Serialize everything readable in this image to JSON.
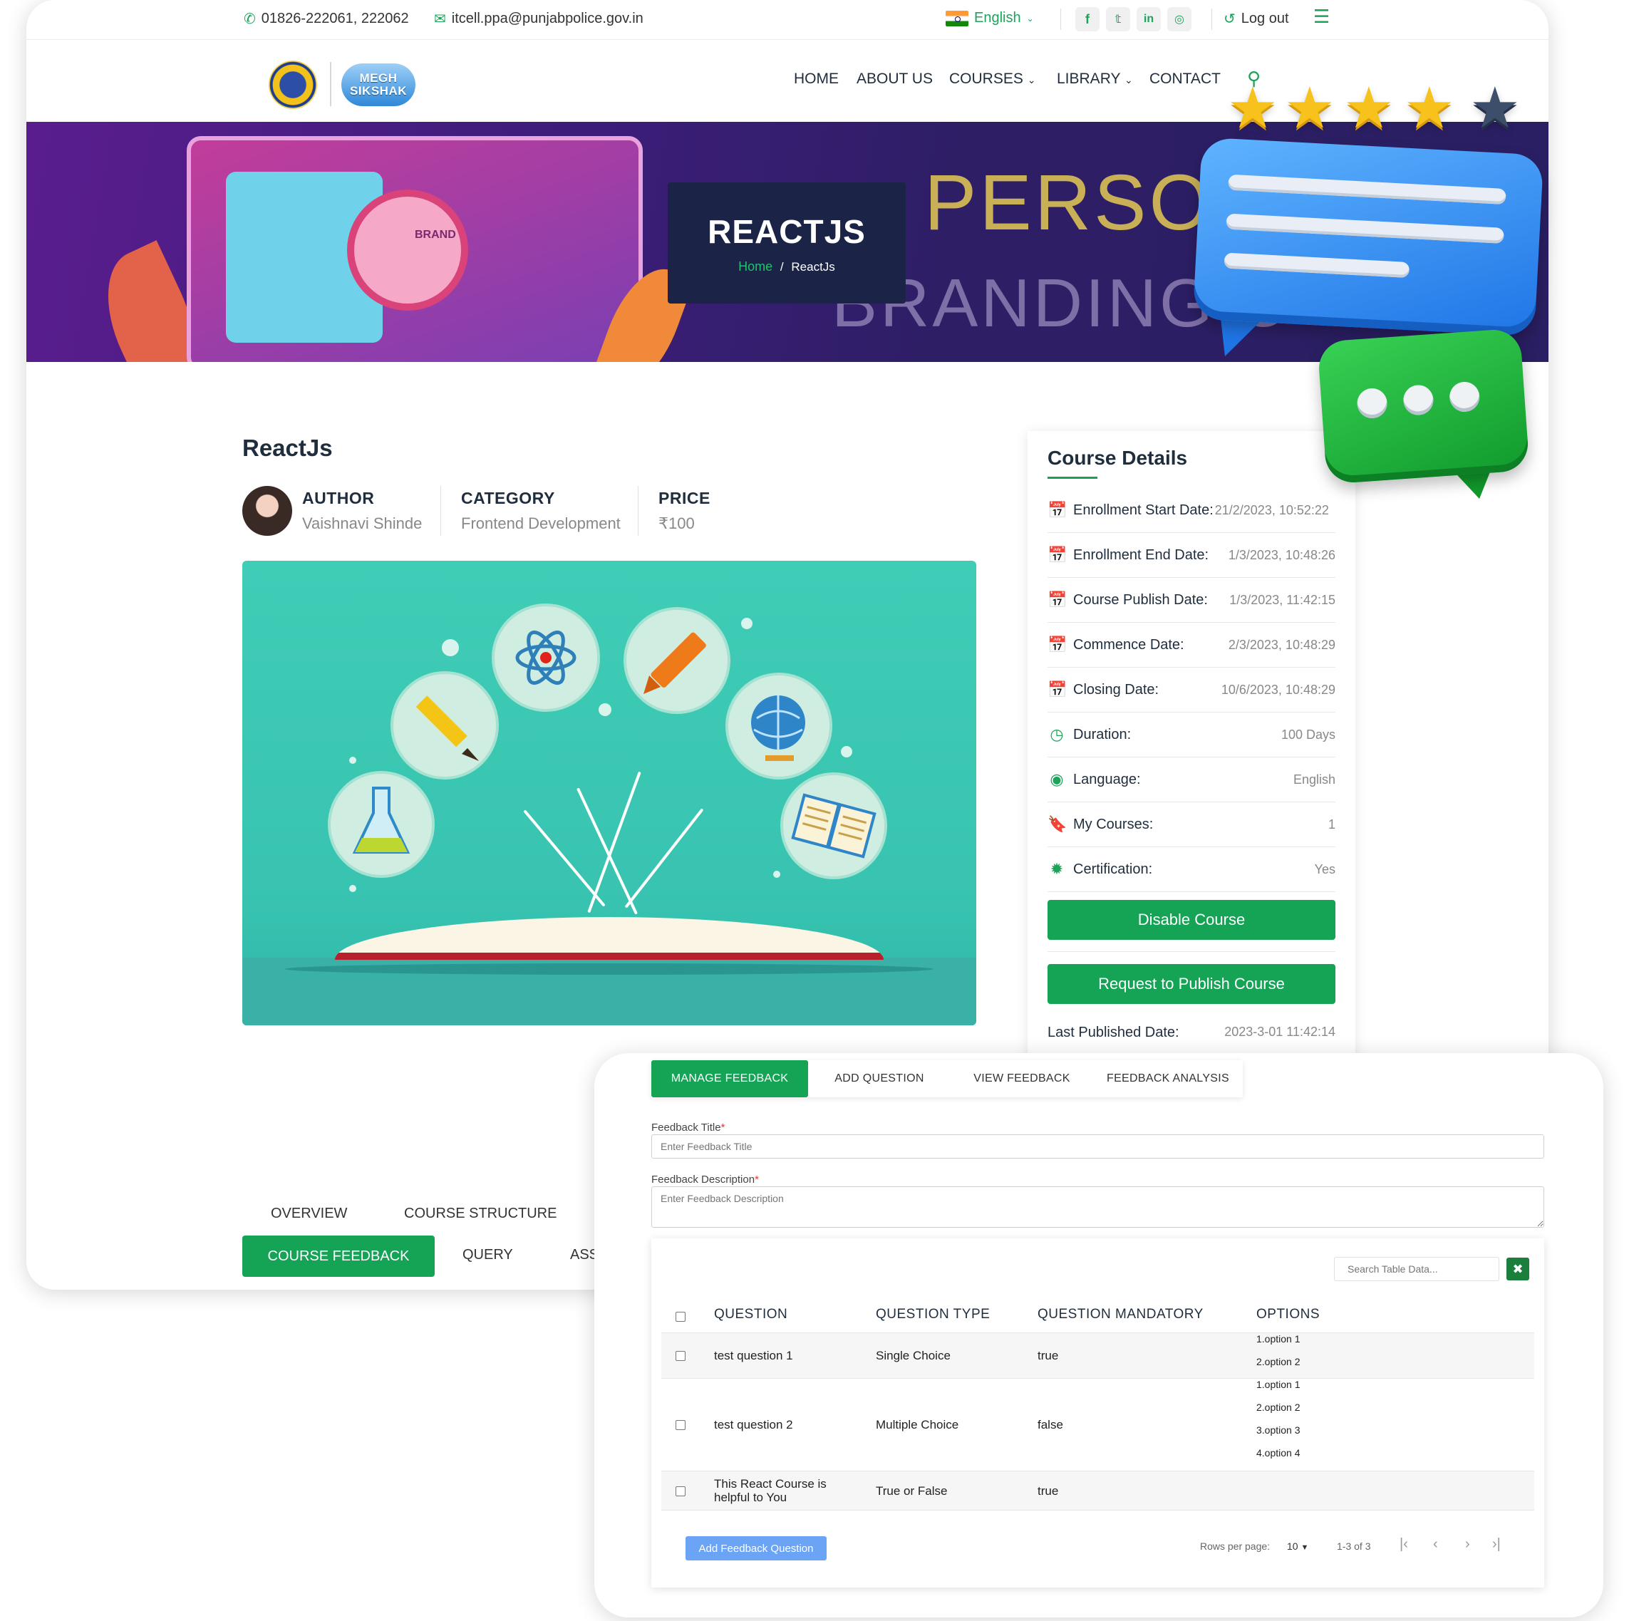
{
  "topbar": {
    "phone": "01826-222061, 222062",
    "email": "itcell.ppa@punjabpolice.gov.in",
    "language": "English",
    "logout": "Log out",
    "social": [
      "f",
      "t",
      "in",
      "ig"
    ]
  },
  "logo": {
    "brand": "MEGH SIKSHAK"
  },
  "nav": [
    "HOME",
    "ABOUT US",
    "COURSES",
    "LIBRARY",
    "CONTACT"
  ],
  "hero": {
    "title": "REACTJS",
    "breadcrumb_home": "Home",
    "breadcrumb_sep": "/",
    "breadcrumb_current": "ReactJs",
    "bg_text_1": "PERSO",
    "bg_text_2": "BRANDING C",
    "screen_label": "BRAND"
  },
  "course": {
    "title": "ReactJs",
    "author_label": "AUTHOR",
    "author": "Vaishnavi Shinde",
    "category_label": "CATEGORY",
    "category": "Frontend Development",
    "price_label": "PRICE",
    "price": "₹100"
  },
  "course_tabs": {
    "overview": "OVERVIEW",
    "structure": "COURSE STRUCTURE",
    "feedback": "COURSE FEEDBACK",
    "query": "QUERY",
    "ass": "ASS"
  },
  "details": {
    "title": "Course Details",
    "rows": [
      {
        "icon": "calendar-check-icon",
        "label": "Enrollment Start Date:",
        "value": "21/2/2023, 10:52:22"
      },
      {
        "icon": "calendar-check-icon",
        "label": "Enrollment End Date:",
        "value": "1/3/2023, 10:48:26"
      },
      {
        "icon": "calendar-check-icon",
        "label": "Course Publish Date:",
        "value": "1/3/2023, 11:42:15"
      },
      {
        "icon": "calendar-check-icon",
        "label": "Commence Date:",
        "value": "2/3/2023, 10:48:29"
      },
      {
        "icon": "calendar-check-icon",
        "label": "Closing Date:",
        "value": "10/6/2023, 10:48:29"
      },
      {
        "icon": "clock-icon",
        "label": "Duration:",
        "value": "100 Days"
      },
      {
        "icon": "globe-icon",
        "label": "Language:",
        "value": "English"
      },
      {
        "icon": "bookmark-icon",
        "label": "My Courses:",
        "value": "1"
      },
      {
        "icon": "certificate-icon",
        "label": "Certification:",
        "value": "Yes"
      }
    ],
    "disable_btn": "Disable Course",
    "publish_btn": "Request to Publish Course",
    "last_published_label": "Last Published Date:",
    "last_published_value": "2023-3-01 11:42:14"
  },
  "rating": {
    "stars": 4,
    "max": 5
  },
  "feedback": {
    "tabs": [
      "MANAGE FEEDBACK",
      "ADD QUESTION",
      "VIEW FEEDBACK",
      "FEEDBACK ANALYSIS"
    ],
    "title_label": "Feedback Title",
    "title_placeholder": "Enter Feedback Title",
    "desc_label": "Feedback Description",
    "desc_placeholder": "Enter Feedback Description",
    "required_mark": "*",
    "search_placeholder": "Search Table Data...",
    "clear_icon": "✖",
    "columns": [
      "QUESTION",
      "QUESTION TYPE",
      "QUESTION MANDATORY",
      "OPTIONS"
    ],
    "rows": [
      {
        "question": "test question 1",
        "type": "Single Choice",
        "mandatory": "true",
        "options": [
          "1.option 1",
          "2.option 2"
        ]
      },
      {
        "question": "test question 2",
        "type": "Multiple Choice",
        "mandatory": "false",
        "options": [
          "1.option 1",
          "2.option 2",
          "3.option 3",
          "4.option 4"
        ]
      },
      {
        "question": "This React Course is helpful to You",
        "type": "True or False",
        "mandatory": "true",
        "options": []
      }
    ],
    "add_btn": "Add Feedback Question",
    "rows_per_page_label": "Rows per page:",
    "rows_per_page": "10",
    "range": "1-3 of 3"
  }
}
